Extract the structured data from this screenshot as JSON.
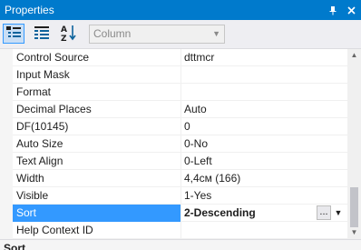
{
  "window": {
    "title": "Properties"
  },
  "titlebar_icons": {
    "pin": "pin-icon",
    "close": "close-icon"
  },
  "toolbar": {
    "categorized_icon": "categorized-icon",
    "alphabetical_icon": "alphabetical-list-icon",
    "sort_az_icon": "sort-az-icon",
    "object_combo": "Column"
  },
  "properties": [
    {
      "name": "Control Source",
      "value": "dttmcr"
    },
    {
      "name": "Input Mask",
      "value": ""
    },
    {
      "name": "Format",
      "value": ""
    },
    {
      "name": "Decimal Places",
      "value": "Auto"
    },
    {
      "name": "DF(10145)",
      "value": "0"
    },
    {
      "name": "Auto Size",
      "value": "0-No"
    },
    {
      "name": "Text Align",
      "value": "0-Left"
    },
    {
      "name": "Width",
      "value": "4,4см (166)"
    },
    {
      "name": "Visible",
      "value": "1-Yes"
    },
    {
      "name": "Sort",
      "value": "2-Descending",
      "selected": true
    },
    {
      "name": "Help Context ID",
      "value": ""
    }
  ],
  "selected_row": {
    "ellipsis": "...",
    "dropdown": "▼"
  },
  "bottom_strip": {
    "text": "Sort"
  },
  "colors": {
    "accent": "#007acc",
    "selection": "#3399ff"
  }
}
